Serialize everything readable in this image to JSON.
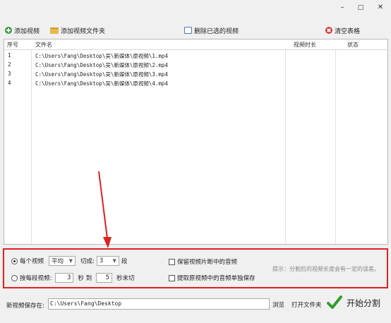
{
  "window": {
    "minimize_glyph": "–",
    "maximize_glyph": "□",
    "close_glyph": "✕"
  },
  "toolbar": {
    "add_video": "添加视频",
    "add_folder": "添加视频文件夹",
    "delete_selected": "删除已选的视频",
    "clear_table": "清空表格"
  },
  "table": {
    "headers": [
      "序号",
      "文件名",
      "视频时长",
      "状态"
    ],
    "rows": [
      {
        "index": "1",
        "filename": "C:\\Users\\Fang\\Desktop\\吴\\新媒体\\原视频\\1.mp4",
        "duration": "",
        "status": ""
      },
      {
        "index": "2",
        "filename": "C:\\Users\\Fang\\Desktop\\吴\\新媒体\\原视频\\2.mp4",
        "duration": "",
        "status": ""
      },
      {
        "index": "3",
        "filename": "C:\\Users\\Fang\\Desktop\\吴\\新媒体\\原视频\\3.mp4",
        "duration": "",
        "status": ""
      },
      {
        "index": "4",
        "filename": "C:\\Users\\Fang\\Desktop\\吴\\新媒体\\原视频\\4.mp4",
        "duration": "",
        "status": ""
      }
    ]
  },
  "options": {
    "per_video_label": "每个视频",
    "mode_value": "平均",
    "cut_label": "切成:",
    "segments_value": "3",
    "segments_unit": "段",
    "per_segment_label": "按每段视频:",
    "from_value": "3",
    "sec_label": "秒 到",
    "to_value": "5",
    "sec_end_label": "秒末切",
    "keep_audio_label": "保留视频片断中的音频",
    "extract_audio_label": "提取原视频中的音频单独保存",
    "hint": "提示：分割后的视频长度会有一定的误差。"
  },
  "bottom": {
    "save_label": "新视频保存在:",
    "save_path": "C:\\Users\\Fang\\Desktop",
    "browse": "浏览",
    "open_folder": "打开文件夹",
    "start": "开始分割"
  },
  "colors": {
    "highlight": "#e02020",
    "start_check": "#2e9c2e"
  }
}
